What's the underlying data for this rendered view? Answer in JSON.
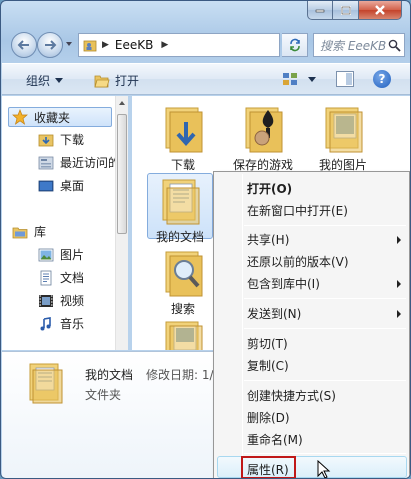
{
  "window": {
    "caption_buttons": {
      "minimize": "minimize",
      "maximize": "maximize",
      "close": "close"
    }
  },
  "address": {
    "crumb": "EeeKB",
    "search_placeholder": "搜索 EeeKB"
  },
  "toolbar": {
    "organize": "组织",
    "open": "打开"
  },
  "nav": {
    "favorites": "收藏夹",
    "downloads": "下载",
    "recent": "最近访问的",
    "desktop": "桌面",
    "libraries": "库",
    "pictures": "图片",
    "documents": "文档",
    "videos": "视频",
    "music": "音乐"
  },
  "files": [
    {
      "label": "下载",
      "icon": "downloads-folder-icon"
    },
    {
      "label": "保存的游戏",
      "icon": "saved-games-folder-icon"
    },
    {
      "label": "我的图片",
      "icon": "pictures-folder-icon"
    },
    {
      "label": "我的文档",
      "icon": "documents-folder-icon"
    },
    {
      "label": "搜索",
      "icon": "searches-folder-icon"
    },
    {
      "label": "",
      "icon": "folder-icon"
    }
  ],
  "details": {
    "name": "我的文档",
    "modified": "修改日期: 1/",
    "type": "文件夹"
  },
  "context_menu": {
    "items": [
      {
        "label": "打开(O)",
        "bold": true
      },
      {
        "label": "在新窗口中打开(E)"
      },
      {
        "label": "共享(H)",
        "submenu": true
      },
      {
        "label": "还原以前的版本(V)"
      },
      {
        "label": "包含到库中(I)",
        "submenu": true
      },
      {
        "label": "发送到(N)",
        "submenu": true
      },
      {
        "label": "剪切(T)"
      },
      {
        "label": "复制(C)"
      },
      {
        "label": "创建快捷方式(S)"
      },
      {
        "label": "删除(D)"
      },
      {
        "label": "重命名(M)"
      },
      {
        "label": "属性(R)"
      }
    ]
  },
  "colors": {
    "highlight": "#c01818",
    "accent": "#84acdd"
  }
}
